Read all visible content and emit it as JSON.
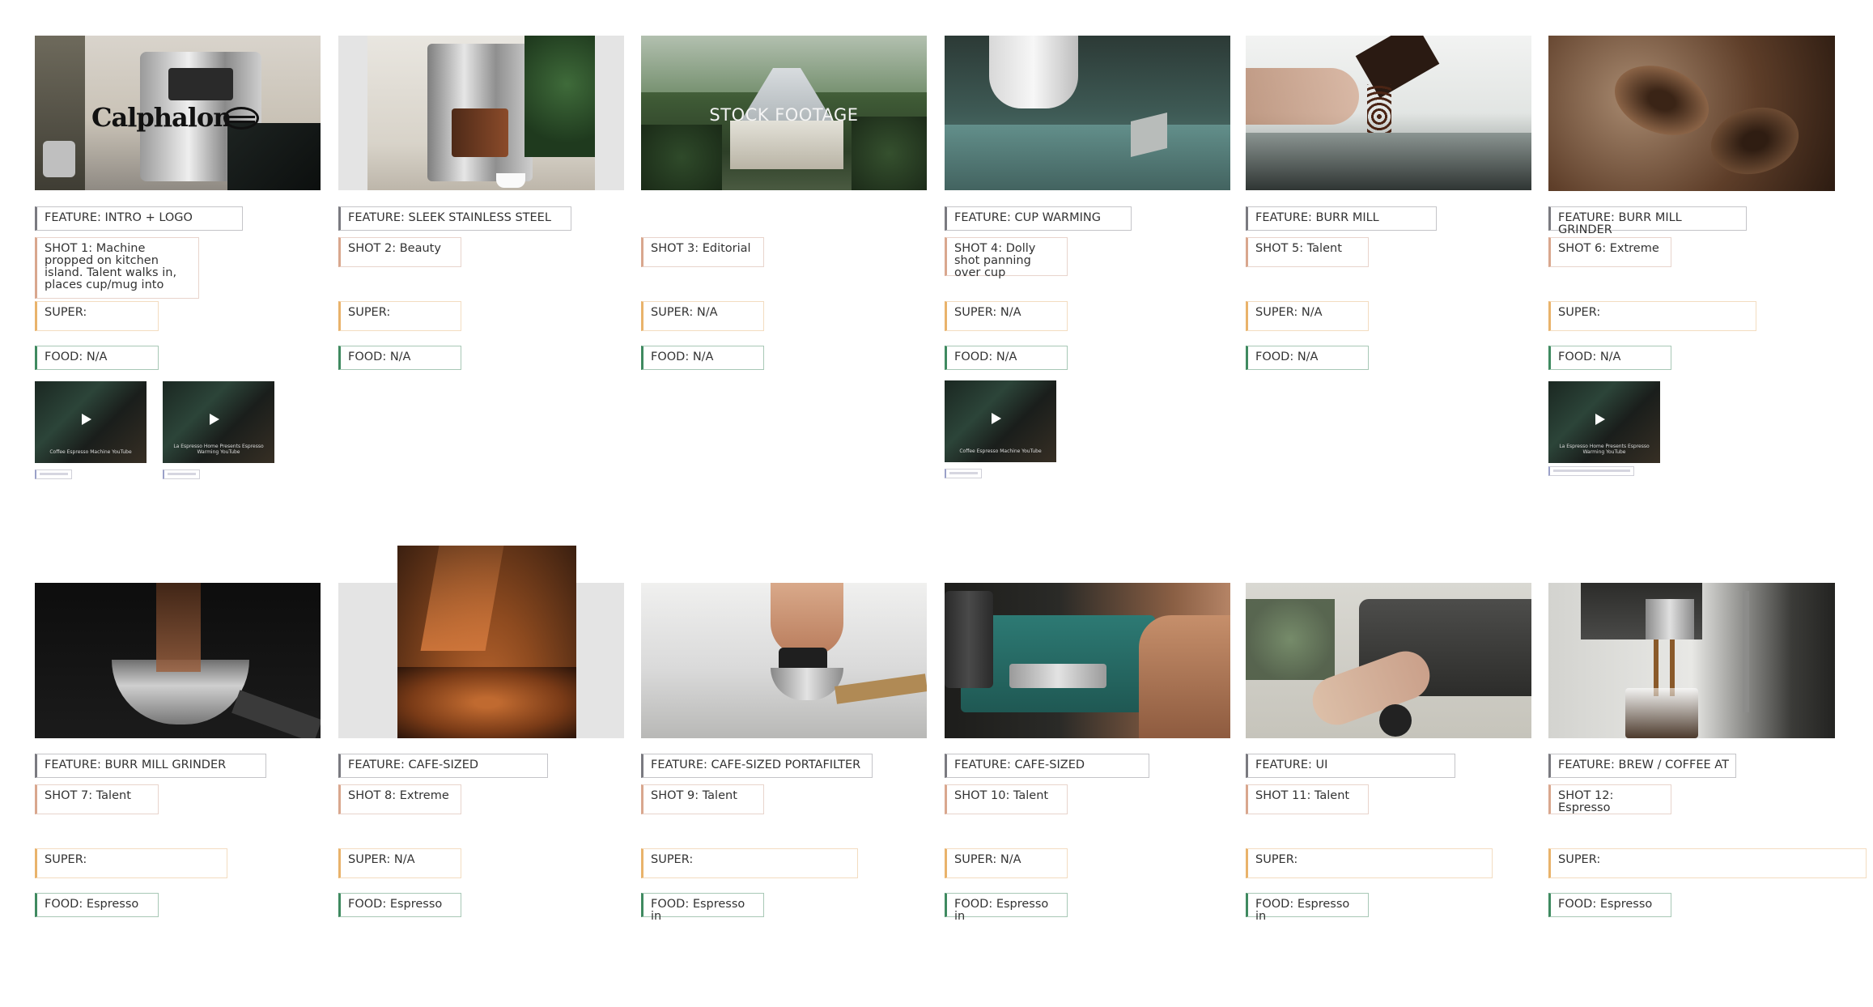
{
  "shots": [
    {
      "feature": "FEATURE: INTRO + LOGO",
      "shot": "SHOT 1: Machine propped on kitchen island. Talent walks in, places cup/mug into",
      "super": "SUPER:",
      "food": "FOOD: N/A",
      "logo": "Calphalon",
      "videos": [
        {
          "caption": "Coffee Espresso Machine\nYouTube"
        },
        {
          "caption": "La Espresso Home Presents Espresso Warming\nYouTube"
        }
      ]
    },
    {
      "feature": "FEATURE: SLEEK STAINLESS STEEL",
      "shot": "SHOT 2: Beauty",
      "super": "SUPER:",
      "food": "FOOD: N/A"
    },
    {
      "feature": "",
      "shot": "SHOT 3: Editorial",
      "super": "SUPER: N/A",
      "food": "FOOD: N/A",
      "overlay": "STOCK FOOTAGE"
    },
    {
      "feature": "FEATURE: CUP WARMING",
      "shot": "SHOT 4: Dolly shot panning over cup",
      "super": "SUPER: N/A",
      "food": "FOOD: N/A",
      "videos": [
        {
          "caption": "Coffee Espresso Machine\nYouTube"
        }
      ]
    },
    {
      "feature": "FEATURE: BURR MILL",
      "shot": "SHOT 5: Talent",
      "super": "SUPER: N/A",
      "food": "FOOD: N/A"
    },
    {
      "feature": "FEATURE: BURR MILL GRINDER",
      "shot": "SHOT 6: Extreme",
      "super": "SUPER:",
      "food": "FOOD: N/A",
      "videos": [
        {
          "caption": "La Espresso Home Presents Espresso Warming\nYouTube"
        }
      ]
    },
    {
      "feature": "FEATURE: BURR MILL GRINDER",
      "shot": "SHOT 7: Talent",
      "super": "SUPER:",
      "food": "FOOD: Espresso"
    },
    {
      "feature": "FEATURE: CAFE-SIZED",
      "shot": "SHOT 8: Extreme",
      "super": "SUPER: N/A",
      "food": "FOOD: Espresso"
    },
    {
      "feature": "FEATURE: CAFE-SIZED PORTAFILTER",
      "shot": "SHOT 9: Talent",
      "super": "SUPER:",
      "food": "FOOD: Espresso in"
    },
    {
      "feature": "FEATURE: CAFE-SIZED",
      "shot": "SHOT 10: Talent",
      "super": "SUPER: N/A",
      "food": "FOOD: Espresso in"
    },
    {
      "feature": "FEATURE: UI",
      "shot": "SHOT 11: Talent",
      "super": "SUPER:",
      "food": "FOOD: Espresso in"
    },
    {
      "feature": "FEATURE: BREW / COFFEE AT",
      "shot": "SHOT 12: Espresso",
      "super": "SUPER:",
      "food": "FOOD: Espresso"
    }
  ]
}
